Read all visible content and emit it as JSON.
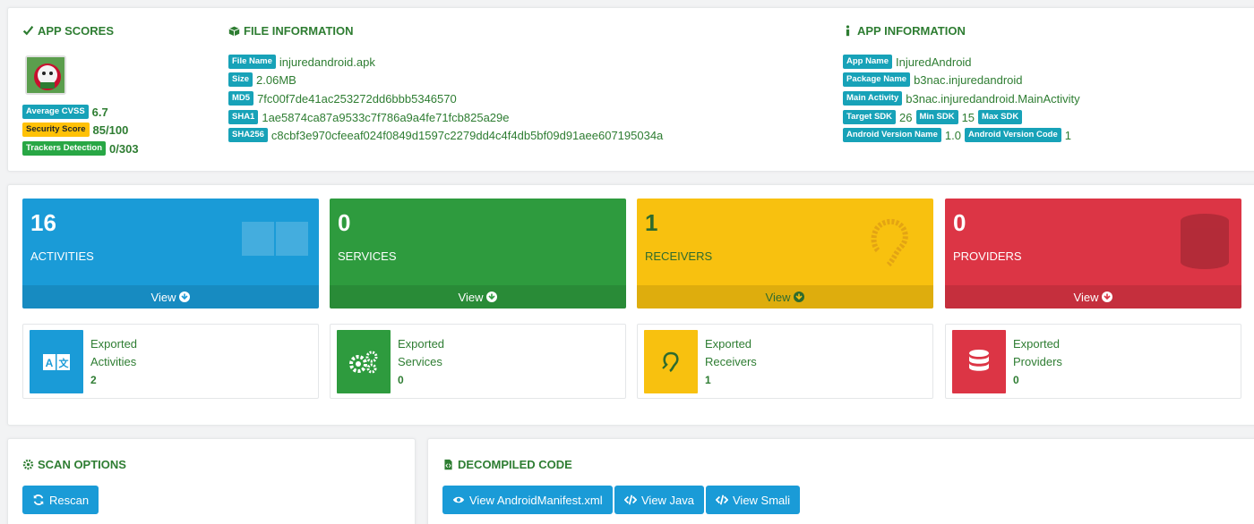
{
  "app_scores": {
    "title": "APP SCORES",
    "cvss_label": "Average CVSS",
    "cvss_value": "6.7",
    "security_label": "Security Score",
    "security_value": "85/100",
    "trackers_label": "Trackers Detection",
    "trackers_value": "0/303"
  },
  "file_info": {
    "title": "FILE INFORMATION",
    "rows": [
      {
        "label": "File Name",
        "value": "injuredandroid.apk"
      },
      {
        "label": "Size",
        "value": "2.06MB"
      },
      {
        "label": "MD5",
        "value": "7fc00f7de41ac253272dd6bbb5346570"
      },
      {
        "label": "SHA1",
        "value": "1ae5874ca87a9533c7f786a9a4fe71fcb825a29e"
      },
      {
        "label": "SHA256",
        "value": "c8cbf3e970cfeeaf024f0849d1597c2279dd4c4f4db5bf09d91aee607195034a"
      }
    ]
  },
  "app_info": {
    "title": "APP INFORMATION",
    "app_name_label": "App Name",
    "app_name": "InjuredAndroid",
    "package_label": "Package Name",
    "package": "b3nac.injuredandroid",
    "main_activity_label": "Main Activity",
    "main_activity": "b3nac.injuredandroid.MainActivity",
    "target_sdk_label": "Target SDK",
    "target_sdk": "26",
    "min_sdk_label": "Min SDK",
    "min_sdk": "15",
    "max_sdk_label": "Max SDK",
    "version_name_label": "Android Version Name",
    "version_name": "1.0",
    "version_code_label": "Android Version Code",
    "version_code": "1"
  },
  "components": [
    {
      "count": "16",
      "label": "ACTIVITIES",
      "view": "View",
      "exported_line1": "Exported",
      "exported_line2": "Activities",
      "exported_count": "2"
    },
    {
      "count": "0",
      "label": "SERVICES",
      "view": "View",
      "exported_line1": "Exported",
      "exported_line2": "Services",
      "exported_count": "0"
    },
    {
      "count": "1",
      "label": "RECEIVERS",
      "view": "View",
      "exported_line1": "Exported",
      "exported_line2": "Receivers",
      "exported_count": "1"
    },
    {
      "count": "0",
      "label": "PROVIDERS",
      "view": "View",
      "exported_line1": "Exported",
      "exported_line2": "Providers",
      "exported_count": "0"
    }
  ],
  "scan_options": {
    "title": "SCAN OPTIONS",
    "rescan": "Rescan"
  },
  "decompiled": {
    "title": "DECOMPILED CODE",
    "manifest": "View AndroidManifest.xml",
    "java": "View Java",
    "smali": "View Smali"
  },
  "colors": {
    "accent_green": "#2e7d32",
    "info": "#17a2b8",
    "activities": "#1a9bd7",
    "services": "#2e9b3e",
    "receivers": "#f8c10f",
    "providers": "#dc3545"
  }
}
